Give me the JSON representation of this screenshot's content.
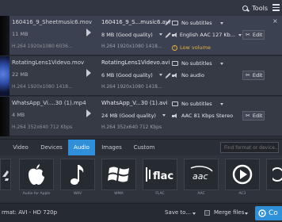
{
  "topbar": {
    "tools_label": "Tools"
  },
  "files": [
    {
      "src_name": "160416_9_Sheetmusic6.mov",
      "src_size": "11 MB",
      "src_meta": "H.264 1920x1080 6036...",
      "out_name": "160416_9_S...music6.avi",
      "out_size": "8 MB (Good quality)",
      "out_meta": "H.264 1920x1080 1418...",
      "subtitles": "No subtitles",
      "audio": "English AAC 127 Kb...",
      "warning": "Low volume",
      "edit_label": "Edit"
    },
    {
      "src_name": "RotatingLens1Videvo.mov",
      "src_size": "22 MB",
      "src_meta": "H.264 1920x1080 1418...",
      "out_name": "RotatingLens1Videvo.avi",
      "out_size": "6 MB (Good quality)",
      "out_meta": "H.264 1920x1080 1418...",
      "subtitles": "No subtitles",
      "audio": "No audio",
      "edit_label": "Edit"
    },
    {
      "src_name": "WhatsApp_Vi....30 (1).mp4",
      "src_size": "4 MB",
      "src_meta": "H.264 352x640 712 Kbps",
      "out_name": "WhatsApp_V...30 (1).avi",
      "out_size": "24 MB (Good quality)",
      "out_meta": "H.264 352x640 712 Kbps",
      "subtitles": "No subtitles",
      "audio": "AAC 81 Kbps Stereo",
      "edit_label": "Edit"
    }
  ],
  "tabs": [
    "Video",
    "Devices",
    "Audio",
    "Images",
    "Custom"
  ],
  "active_tab": "Audio",
  "search_placeholder": "Find format or device...",
  "formats": [
    {
      "label": "Audio for Apple",
      "icon": "apple-icon"
    },
    {
      "label": "WAV",
      "icon": "music-note-icon"
    },
    {
      "label": "WMA",
      "icon": "windows-icon"
    },
    {
      "label": "FLAC",
      "icon": "flac-icon"
    },
    {
      "label": "AAC",
      "icon": "aac-icon"
    },
    {
      "label": "AC3",
      "icon": "play-circle-icon"
    }
  ],
  "bottom": {
    "output_format": "rmat: AVI - HD 720p",
    "save_to": "Save to...",
    "merge_files": "Merge files",
    "convert_label": "Co"
  },
  "colors": {
    "accent": "#2f8fd8",
    "warning": "#e8b13a"
  }
}
